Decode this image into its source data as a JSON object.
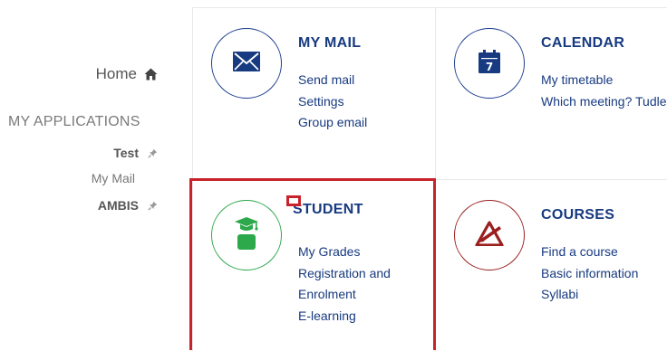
{
  "sidebar": {
    "home_label": "Home",
    "section_heading": "MY APPLICATIONS",
    "apps": [
      {
        "label": "Test",
        "pinned": true
      },
      {
        "label": "My Mail",
        "pinned": false
      },
      {
        "label": "AMBIS",
        "pinned": true
      }
    ]
  },
  "tiles": {
    "mail": {
      "title": "MY MAIL",
      "icon": "envelope-icon",
      "links": [
        "Send mail",
        "Settings",
        "Group email"
      ]
    },
    "calendar": {
      "title": "CALENDAR",
      "icon": "calendar-icon",
      "calendar_day": "7",
      "links": [
        "My timetable",
        "Which meeting? Tudle"
      ]
    },
    "student": {
      "title": "STUDENT",
      "icon": "graduate-icon",
      "links": [
        "My Grades",
        "Registration and",
        "Enrolment",
        "E-learning"
      ]
    },
    "courses": {
      "title": "COURSES",
      "icon": "compass-icon",
      "links": [
        "Find a course",
        "Basic information",
        "Syllabi"
      ]
    }
  },
  "colors": {
    "brand_blue": "#173a80",
    "student_green": "#2da84a",
    "courses_red": "#9a1f1f",
    "highlight_red": "#c8232c"
  }
}
